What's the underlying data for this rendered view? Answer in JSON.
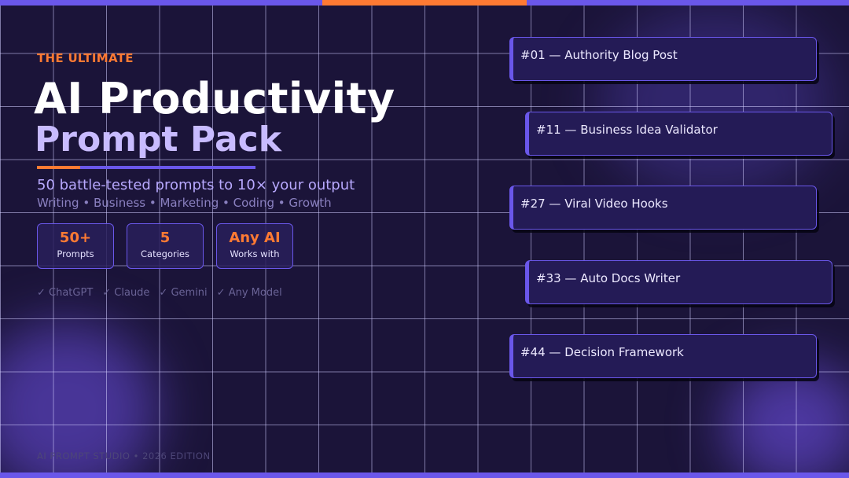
{
  "eyebrow": "THE ULTIMATE",
  "title_line1": "AI Productivity",
  "title_line2": "Prompt Pack",
  "subtitle": "50 battle-tested prompts to 10× your output",
  "topics": "Writing • Business • Marketing • Coding • Growth",
  "stats": [
    {
      "value": "50+",
      "label": "Prompts"
    },
    {
      "value": "5",
      "label": "Categories"
    },
    {
      "value": "Any AI",
      "label": "Works with"
    }
  ],
  "compatibility": [
    "✓  ChatGPT",
    "✓  Claude",
    "✓  Gemini",
    "✓  Any Model"
  ],
  "footer": "AI PROMPT STUDIO  •  2026 EDITION",
  "prompt_cards": [
    "#01 — Authority Blog Post",
    "#11 — Business Idea Validator",
    "#27 — Viral Video Hooks",
    "#33 — Auto Docs Writer",
    "#44 — Decision Framework"
  ],
  "colors": {
    "background": "#1b1439",
    "accent_orange": "#ff7a33",
    "accent_purple": "#6a57ea",
    "title_secondary": "#c8bbff"
  }
}
